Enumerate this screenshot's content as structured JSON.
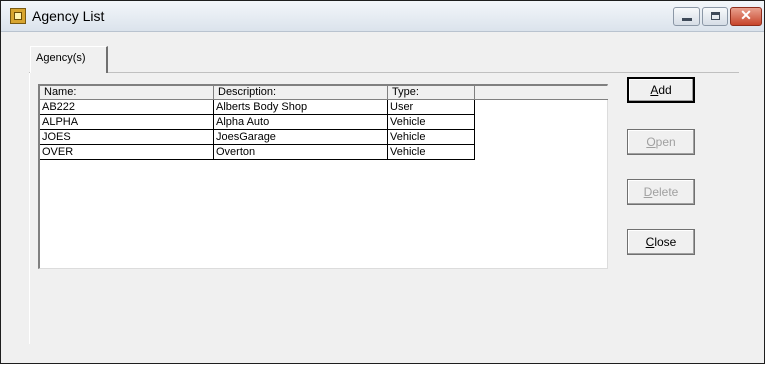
{
  "window": {
    "title": "Agency List"
  },
  "tab": {
    "label": "Agency(s)"
  },
  "table": {
    "columns": [
      "Name:",
      "Description:",
      "Type:",
      ""
    ],
    "rows": [
      {
        "name": "AB222",
        "description": "Alberts Body Shop",
        "type": "User"
      },
      {
        "name": "ALPHA",
        "description": "Alpha Auto",
        "type": "Vehicle"
      },
      {
        "name": "JOES",
        "description": "JoesGarage",
        "type": "Vehicle"
      },
      {
        "name": "OVER",
        "description": "Overton",
        "type": "Vehicle"
      }
    ]
  },
  "buttons": {
    "add": {
      "mnemonic": "A",
      "rest": "dd",
      "enabled": true
    },
    "open": {
      "mnemonic": "O",
      "rest": "pen",
      "enabled": false
    },
    "delete": {
      "mnemonic": "D",
      "rest": "elete",
      "enabled": false
    },
    "close": {
      "mnemonic": "C",
      "rest": "lose",
      "enabled": true
    }
  },
  "icons": {
    "app": "agency-list-app-icon",
    "minimize": "minimize-icon",
    "maximize": "maximize-icon",
    "close": "close-icon"
  },
  "colors": {
    "window_close_button": "#c7452b",
    "disabled_text": "#a0a0a0"
  }
}
